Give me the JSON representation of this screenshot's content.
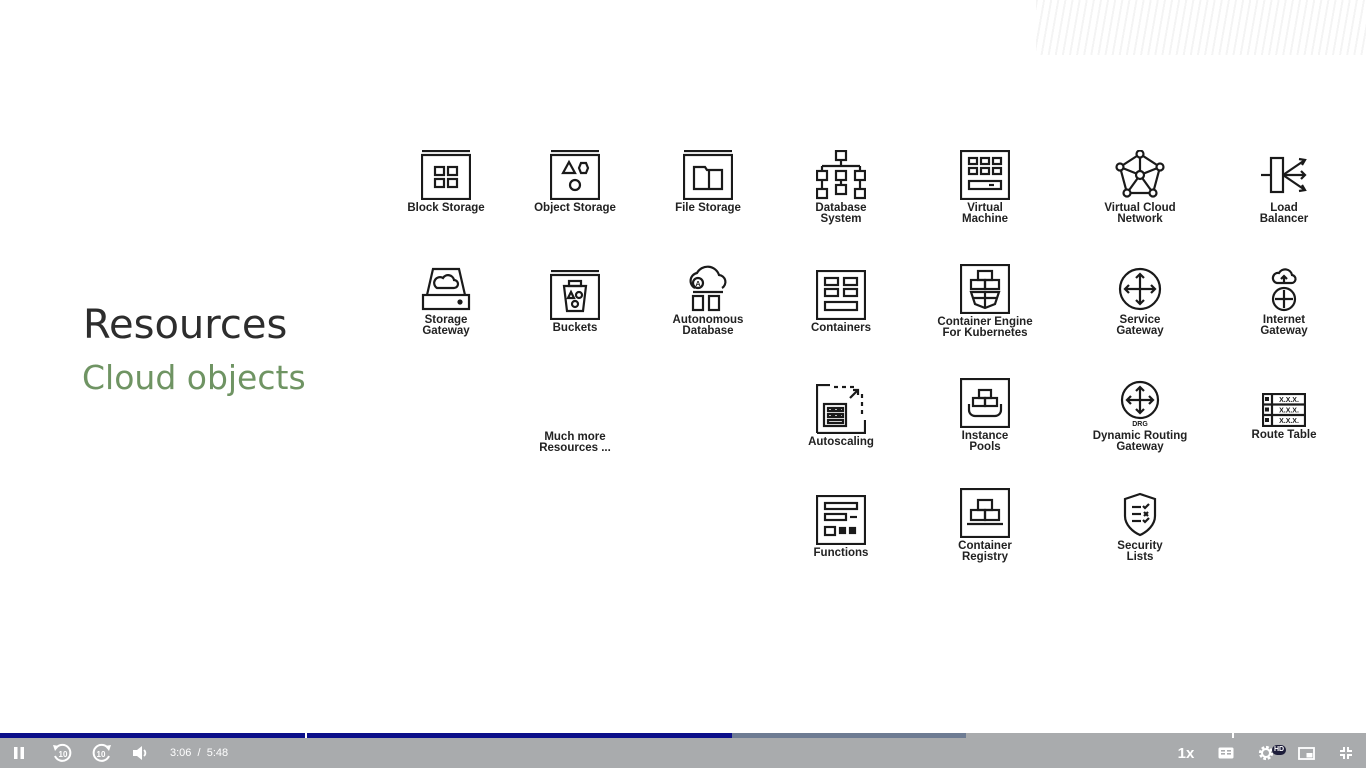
{
  "slide": {
    "title": "Resources",
    "subtitle": "Cloud objects",
    "more_label": "Much more\nResources ...",
    "resources": [
      {
        "label": "Block Storage",
        "icon": "block-storage-icon"
      },
      {
        "label": "Object Storage",
        "icon": "object-storage-icon"
      },
      {
        "label": "File Storage",
        "icon": "file-storage-icon"
      },
      {
        "label": "Database\nSystem",
        "icon": "database-system-icon"
      },
      {
        "label": "Virtual\nMachine",
        "icon": "virtual-machine-icon"
      },
      {
        "label": "Virtual Cloud\nNetwork",
        "icon": "virtual-cloud-network-icon"
      },
      {
        "label": "Load\nBalancer",
        "icon": "load-balancer-icon"
      },
      {
        "label": "Storage\nGateway",
        "icon": "storage-gateway-icon"
      },
      {
        "label": "Buckets",
        "icon": "buckets-icon"
      },
      {
        "label": "Autonomous\nDatabase",
        "icon": "autonomous-database-icon"
      },
      {
        "label": "Containers",
        "icon": "containers-icon"
      },
      {
        "label": "Container Engine\nFor Kubernetes",
        "icon": "kubernetes-engine-icon"
      },
      {
        "label": "Service\nGateway",
        "icon": "service-gateway-icon"
      },
      {
        "label": "Internet\nGateway",
        "icon": "internet-gateway-icon"
      },
      {
        "label": "Autoscaling",
        "icon": "autoscaling-icon"
      },
      {
        "label": "Instance\nPools",
        "icon": "instance-pools-icon"
      },
      {
        "label": "Dynamic Routing\nGateway",
        "icon": "drg-icon",
        "icon_text": "DRG"
      },
      {
        "label": "Route Table",
        "icon": "route-table-icon",
        "icon_text": "X.X.X."
      },
      {
        "label": "Functions",
        "icon": "functions-icon"
      },
      {
        "label": "Container\nRegistry",
        "icon": "container-registry-icon"
      },
      {
        "label": "Security\nLists",
        "icon": "security-lists-icon"
      }
    ]
  },
  "player": {
    "current_time": "3:06",
    "separator": "/",
    "duration": "5:48",
    "played_fraction": 0.536,
    "buffered_fraction": 0.707,
    "speed_label": "1x",
    "hd_badge": "HD",
    "colors": {
      "played": "#0b0f8a",
      "buffered": "#6e7c93",
      "track": "#a9abad",
      "bar": "#a9abad"
    },
    "buttons": [
      "pause-icon",
      "rewind-10-icon",
      "forward-10-icon",
      "volume-icon",
      "captions-icon",
      "settings-icon",
      "picture-in-picture-icon",
      "exit-fullscreen-icon"
    ]
  }
}
